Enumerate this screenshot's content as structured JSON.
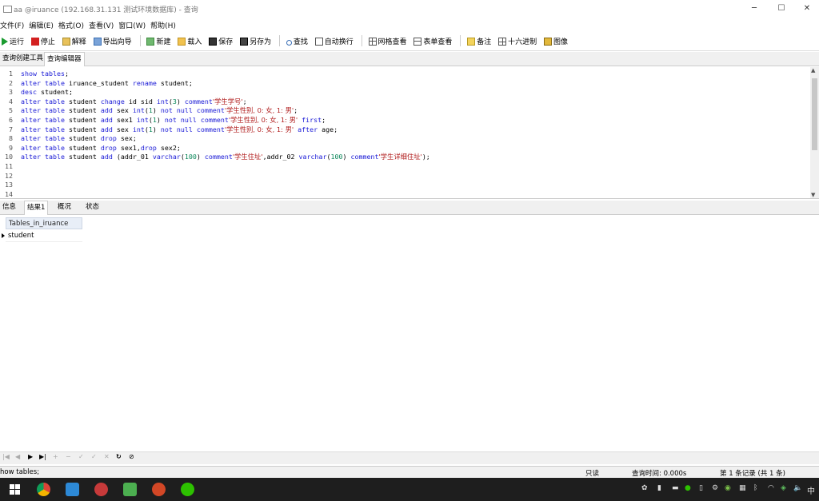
{
  "window": {
    "title": "aa @iruance (192.168.31.131 测试环境数据库) - 查询",
    "minimize": "─",
    "maximize": "☐",
    "close": "✕"
  },
  "menu": [
    "文件(F)",
    "编辑(E)",
    "格式(O)",
    "查看(V)",
    "窗口(W)",
    "帮助(H)"
  ],
  "toolbar": {
    "run": "运行",
    "stop": "停止",
    "explain": "解释",
    "export_wizard": "导出向导",
    "new": "新建",
    "load": "载入",
    "save": "保存",
    "save_as": "另存为",
    "find": "查找",
    "word_wrap": "自动换行",
    "grid_view": "网格查看",
    "form_view": "表单查看",
    "memo": "备注",
    "hex": "十六进制",
    "image": "图像"
  },
  "tabs": {
    "query_builder": "查询创建工具",
    "query_editor": "查询编辑器"
  },
  "editor": {
    "line_numbers": [
      "1",
      "2",
      "3",
      "4",
      "5",
      "6",
      "7",
      "8",
      "9",
      "10",
      "11",
      "12",
      "13",
      "14"
    ],
    "lines": [
      [
        {
          "t": "kw",
          "v": "show tables"
        },
        {
          "t": "p",
          "v": ";"
        }
      ],
      [
        {
          "t": "kw",
          "v": "alter table"
        },
        {
          "t": "p",
          "v": " iruance_student "
        },
        {
          "t": "kw",
          "v": "rename"
        },
        {
          "t": "p",
          "v": " student;"
        }
      ],
      [
        {
          "t": "kw",
          "v": "desc"
        },
        {
          "t": "p",
          "v": " student;"
        }
      ],
      [
        {
          "t": "kw",
          "v": "alter table"
        },
        {
          "t": "p",
          "v": " student "
        },
        {
          "t": "kw",
          "v": "change"
        },
        {
          "t": "p",
          "v": " id sid "
        },
        {
          "t": "kw",
          "v": "int"
        },
        {
          "t": "p",
          "v": "("
        },
        {
          "t": "num",
          "v": "3"
        },
        {
          "t": "p",
          "v": ") "
        },
        {
          "t": "kw",
          "v": "comment"
        },
        {
          "t": "str",
          "v": "'学生学号'"
        },
        {
          "t": "p",
          "v": ";"
        }
      ],
      [
        {
          "t": "kw",
          "v": "alter table"
        },
        {
          "t": "p",
          "v": " student "
        },
        {
          "t": "kw",
          "v": "add"
        },
        {
          "t": "p",
          "v": " sex "
        },
        {
          "t": "kw",
          "v": "int"
        },
        {
          "t": "p",
          "v": "("
        },
        {
          "t": "num",
          "v": "1"
        },
        {
          "t": "p",
          "v": ") "
        },
        {
          "t": "kw",
          "v": "not null comment"
        },
        {
          "t": "str",
          "v": "'学生性别, 0: 女, 1: 男'"
        },
        {
          "t": "p",
          "v": ";"
        }
      ],
      [
        {
          "t": "kw",
          "v": "alter table"
        },
        {
          "t": "p",
          "v": " student "
        },
        {
          "t": "kw",
          "v": "add"
        },
        {
          "t": "p",
          "v": " sex1 "
        },
        {
          "t": "kw",
          "v": "int"
        },
        {
          "t": "p",
          "v": "("
        },
        {
          "t": "num",
          "v": "1"
        },
        {
          "t": "p",
          "v": ") "
        },
        {
          "t": "kw",
          "v": "not null comment"
        },
        {
          "t": "str",
          "v": "'学生性别, 0: 女, 1: 男'"
        },
        {
          "t": "p",
          "v": " "
        },
        {
          "t": "kw",
          "v": "first"
        },
        {
          "t": "p",
          "v": ";"
        }
      ],
      [
        {
          "t": "kw",
          "v": "alter table"
        },
        {
          "t": "p",
          "v": " student "
        },
        {
          "t": "kw",
          "v": "add"
        },
        {
          "t": "p",
          "v": " sex "
        },
        {
          "t": "kw",
          "v": "int"
        },
        {
          "t": "p",
          "v": "("
        },
        {
          "t": "num",
          "v": "1"
        },
        {
          "t": "p",
          "v": ") "
        },
        {
          "t": "kw",
          "v": "not null comment"
        },
        {
          "t": "str",
          "v": "'学生性别, 0: 女, 1: 男'"
        },
        {
          "t": "p",
          "v": " "
        },
        {
          "t": "kw",
          "v": "after"
        },
        {
          "t": "p",
          "v": " age;"
        }
      ],
      [
        {
          "t": "kw",
          "v": "alter table"
        },
        {
          "t": "p",
          "v": " student "
        },
        {
          "t": "kw",
          "v": "drop"
        },
        {
          "t": "p",
          "v": " sex;"
        }
      ],
      [
        {
          "t": "kw",
          "v": "alter table"
        },
        {
          "t": "p",
          "v": " student "
        },
        {
          "t": "kw",
          "v": "drop"
        },
        {
          "t": "p",
          "v": " sex1,"
        },
        {
          "t": "kw",
          "v": "drop"
        },
        {
          "t": "p",
          "v": " sex2;"
        }
      ],
      [
        {
          "t": "kw",
          "v": "alter table"
        },
        {
          "t": "p",
          "v": " student "
        },
        {
          "t": "kw",
          "v": "add"
        },
        {
          "t": "p",
          "v": " (addr_01 "
        },
        {
          "t": "kw",
          "v": "varchar"
        },
        {
          "t": "p",
          "v": "("
        },
        {
          "t": "num",
          "v": "100"
        },
        {
          "t": "p",
          "v": ") "
        },
        {
          "t": "kw",
          "v": "comment"
        },
        {
          "t": "str",
          "v": "'学生住址'"
        },
        {
          "t": "p",
          "v": ",addr_02 "
        },
        {
          "t": "kw",
          "v": "varchar"
        },
        {
          "t": "p",
          "v": "("
        },
        {
          "t": "num",
          "v": "100"
        },
        {
          "t": "p",
          "v": ") "
        },
        {
          "t": "kw",
          "v": "comment"
        },
        {
          "t": "str",
          "v": "'学生详细住址'"
        },
        {
          "t": "p",
          "v": ");"
        }
      ],
      [],
      [],
      [],
      []
    ]
  },
  "result_tabs": [
    "信息",
    "结果1",
    "概况",
    "状态"
  ],
  "grid": {
    "column": "Tables_in_iruance",
    "rows": [
      "student"
    ]
  },
  "statusbar": {
    "sql": "how tables;",
    "mode": "只读",
    "query_time": "查询时间: 0.000s",
    "records": "第 1 条记录 (共 1 条)"
  },
  "taskbar": {
    "apps": [
      "chrome-icon",
      "finder-icon",
      "navicat-icon",
      "game-icon",
      "powerpoint-icon",
      "wechat-icon"
    ],
    "clock_lang": "中"
  }
}
